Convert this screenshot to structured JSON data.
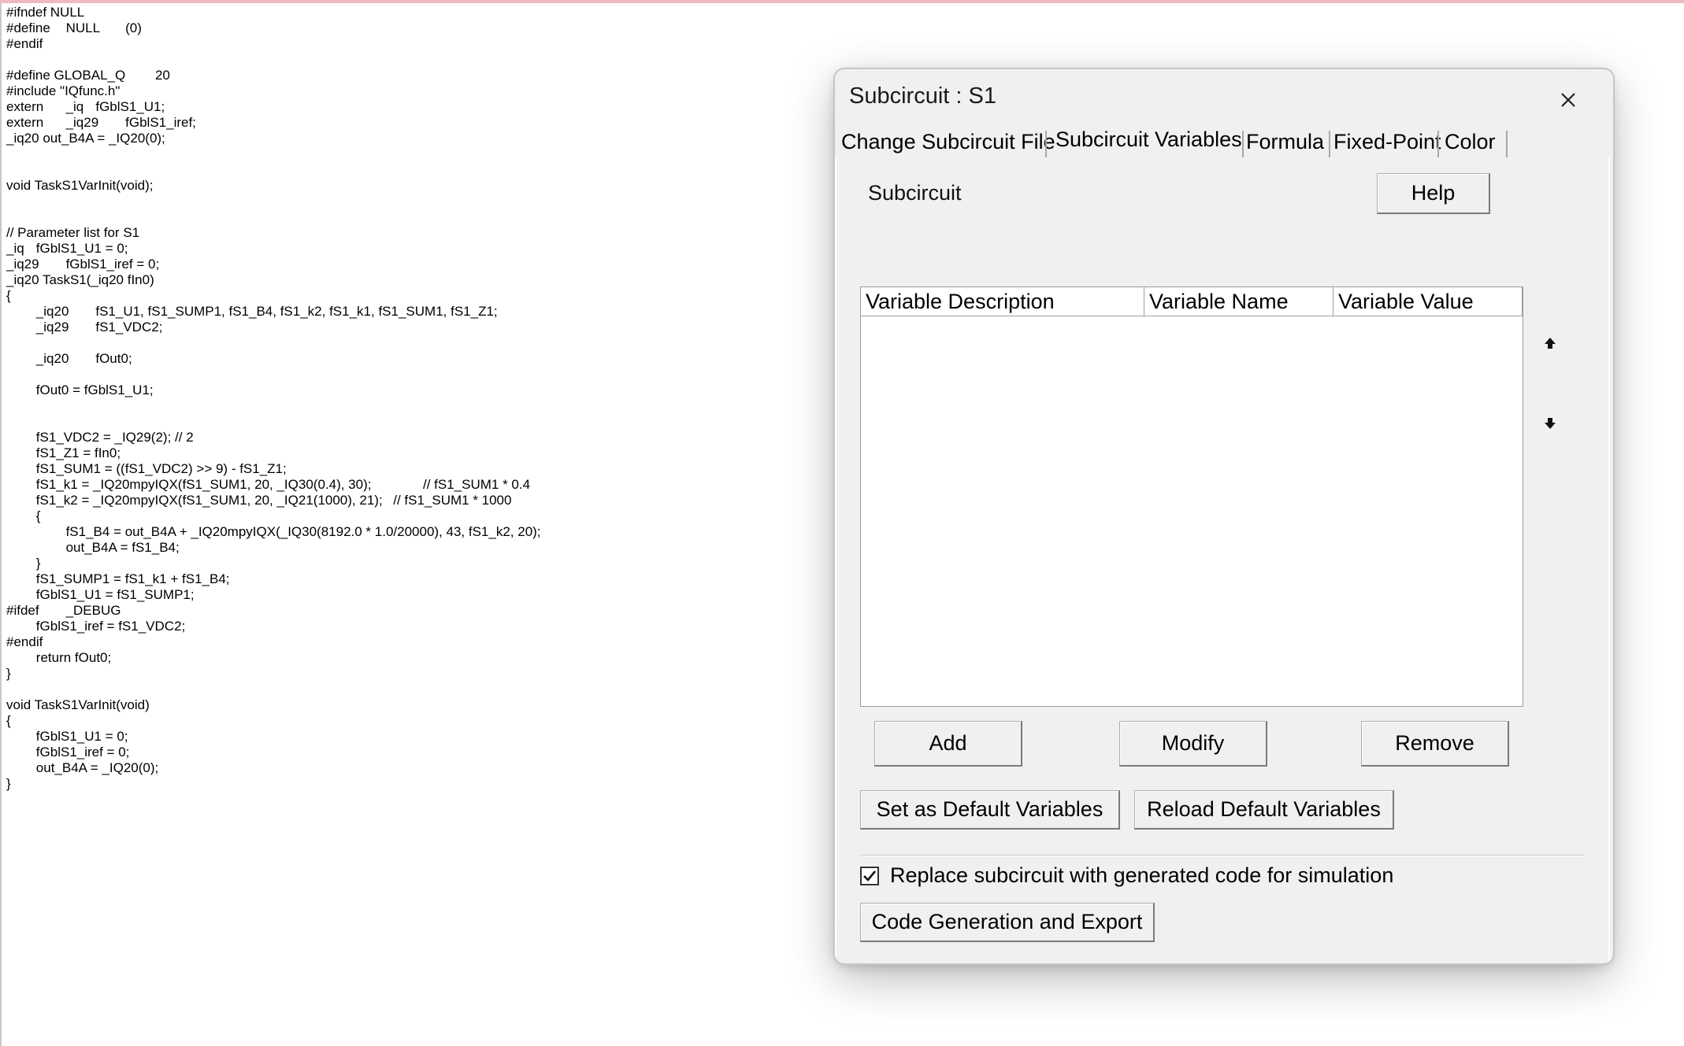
{
  "editor": {
    "lines": [
      "#ifndef NULL",
      "#define\tNULL\t(0)",
      "#endif",
      "",
      "#define GLOBAL_Q\t20",
      "#include \"IQfunc.h\"",
      "extern\t_iq\tfGblS1_U1;",
      "extern\t_iq29\tfGblS1_iref;",
      "_iq20 out_B4A = _IQ20(0);",
      "",
      "",
      "void TaskS1VarInit(void);",
      "",
      "",
      "// Parameter list for S1",
      "_iq\tfGblS1_U1 = 0;",
      "_iq29\tfGblS1_iref = 0;",
      "_iq20 TaskS1(_iq20 fIn0)",
      "{",
      "\t_iq20\tfS1_U1, fS1_SUMP1, fS1_B4, fS1_k2, fS1_k1, fS1_SUM1, fS1_Z1;",
      "\t_iq29\tfS1_VDC2;",
      "",
      "\t_iq20\tfOut0;",
      "",
      "\tfOut0 = fGblS1_U1;",
      "",
      "",
      "\tfS1_VDC2 = _IQ29(2); // 2",
      "\tfS1_Z1 = fIn0;",
      "\tfS1_SUM1 = ((fS1_VDC2) >> 9) - fS1_Z1;",
      "\tfS1_k1 = _IQ20mpyIQX(fS1_SUM1, 20, _IQ30(0.4), 30);\t\t// fS1_SUM1 * 0.4",
      "\tfS1_k2 = _IQ20mpyIQX(fS1_SUM1, 20, _IQ21(1000), 21);\t// fS1_SUM1 * 1000",
      "\t{",
      "\t\tfS1_B4 = out_B4A + _IQ20mpyIQX(_IQ30(8192.0 * 1.0/20000), 43, fS1_k2, 20);",
      "\t\tout_B4A = fS1_B4;",
      "\t}",
      "\tfS1_SUMP1 = fS1_k1 + fS1_B4;",
      "\tfGblS1_U1 = fS1_SUMP1;",
      "#ifdef\t_DEBUG",
      "\tfGblS1_iref = fS1_VDC2;",
      "#endif",
      "\treturn fOut0;",
      "}",
      "",
      "void TaskS1VarInit(void)",
      "{",
      "\tfGblS1_U1 = 0;",
      "\tfGblS1_iref = 0;",
      "\tout_B4A = _IQ20(0);",
      "}"
    ]
  },
  "dialog": {
    "title": "Subcircuit : S1",
    "tabs": [
      {
        "label": "Change Subcircuit File"
      },
      {
        "label": "Subcircuit Variables"
      },
      {
        "label": "Formula"
      },
      {
        "label": "Fixed-Point"
      },
      {
        "label": "Color"
      }
    ],
    "active_tab": "Subcircuit Variables",
    "subcircuit_label": "Subcircuit",
    "help_label": "Help",
    "table": {
      "columns": [
        "Variable Description",
        "Variable Name",
        "Variable Value"
      ],
      "rows": []
    },
    "buttons": {
      "add": "Add",
      "modify": "Modify",
      "remove": "Remove",
      "set_default": "Set as Default Variables",
      "reload_default": "Reload Default Variables",
      "code_gen": "Code Generation and Export"
    },
    "checkbox": {
      "label": "Replace subcircuit with generated code for simulation",
      "checked": true
    }
  },
  "colors": {
    "dialog_bg": "#f0f0f0",
    "top_accent": "#f0b8c0"
  }
}
